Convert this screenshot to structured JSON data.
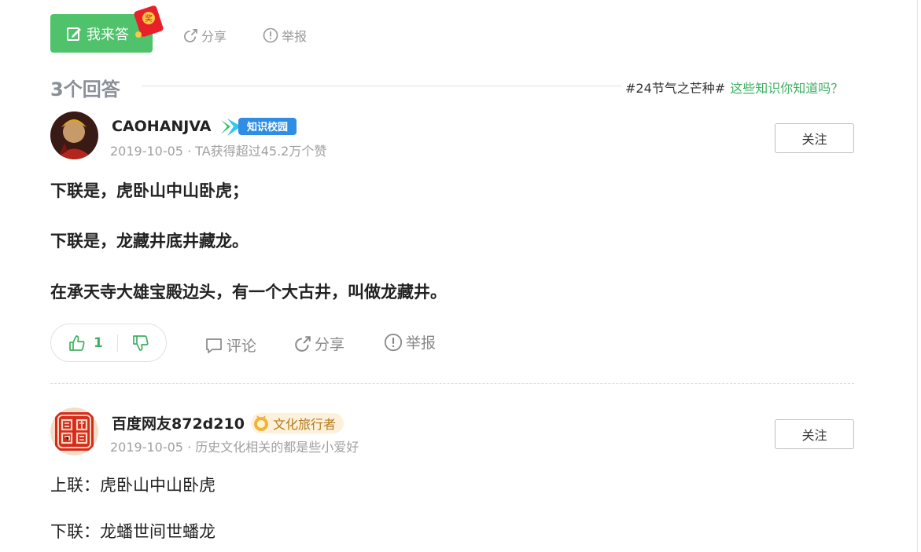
{
  "actions": {
    "answer_label": "我来答",
    "redpacket_text": "奖",
    "share_label": "分享",
    "report_label": "举报"
  },
  "answers_header": {
    "count_label": "3个回答",
    "topic_tag": "#24节气之芒种#",
    "topic_link": "这些知识你知道吗？"
  },
  "answers": [
    {
      "username": "CAOHANJVA",
      "badge": "知识校园",
      "meta": "2019-10-05 · TA获得超过45.2万个赞",
      "follow_label": "关注",
      "paragraphs": [
        "下联是，虎卧山中山卧虎；",
        "下联是，龙藏井底井藏龙。",
        "在承天寺大雄宝殿边头，有一个大古井，叫做龙藏井。"
      ],
      "likes": "1",
      "comment_label": "评论",
      "share_label": "分享",
      "report_label": "举报"
    },
    {
      "username": "百度网友872d210",
      "badge": "文化旅行者",
      "meta": "2019-10-05 · 历史文化相关的都是些小爱好",
      "follow_label": "关注",
      "avatar_seal_text": "居凯 善翔",
      "paragraphs": [
        "上联：虎卧山中山卧虎",
        "下联：龙蟠世间世蟠龙"
      ]
    }
  ],
  "colors": {
    "brand_green": "#4fc26b",
    "link_green": "#3eaf61",
    "muted_text": "#999999"
  }
}
